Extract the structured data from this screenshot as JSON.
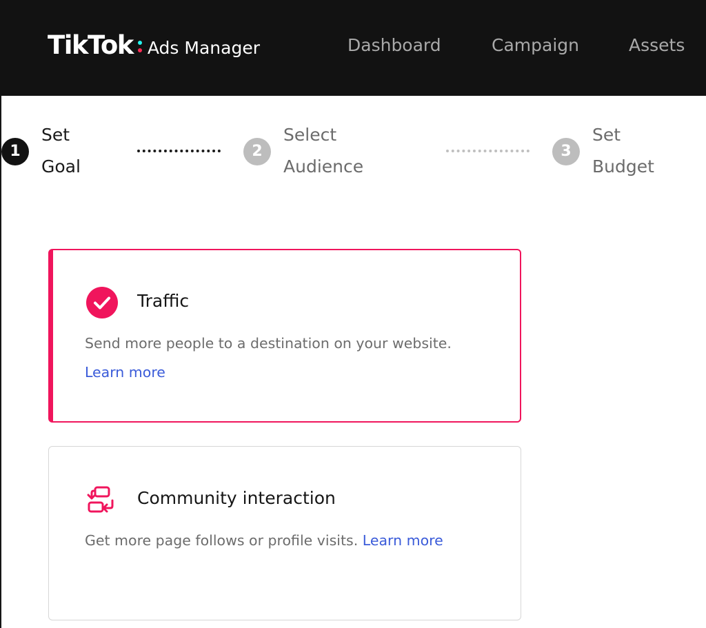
{
  "header": {
    "brand": "TikTok",
    "product": "Ads Manager",
    "brand_colors": {
      "cyan": "#25f4ee",
      "pink": "#fe2c55"
    },
    "nav": [
      {
        "label": "Dashboard"
      },
      {
        "label": "Campaign"
      },
      {
        "label": "Assets"
      }
    ]
  },
  "stepper": {
    "current_step": 1,
    "steps": [
      {
        "number": "1",
        "line1": "Set",
        "line2": "Goal",
        "state": "active"
      },
      {
        "number": "2",
        "line1": "Select",
        "line2": "Audience",
        "state": "inactive"
      },
      {
        "number": "3",
        "line1": "Set",
        "line2": "Budget",
        "state": "inactive"
      }
    ]
  },
  "goals": [
    {
      "title": "Traffic",
      "description": "Send more people to a destination on your website.",
      "link": "Learn more",
      "selected": true,
      "icon": "check-circle-icon"
    },
    {
      "title": "Community interaction",
      "description": "Get more page follows or profile visits.",
      "link": "Learn more",
      "selected": false,
      "icon": "swap-icon"
    }
  ],
  "colors": {
    "accent": "#f0155c",
    "link": "#3a5bd9",
    "header_bg": "#121212",
    "nav_text": "#a9a9a9"
  }
}
